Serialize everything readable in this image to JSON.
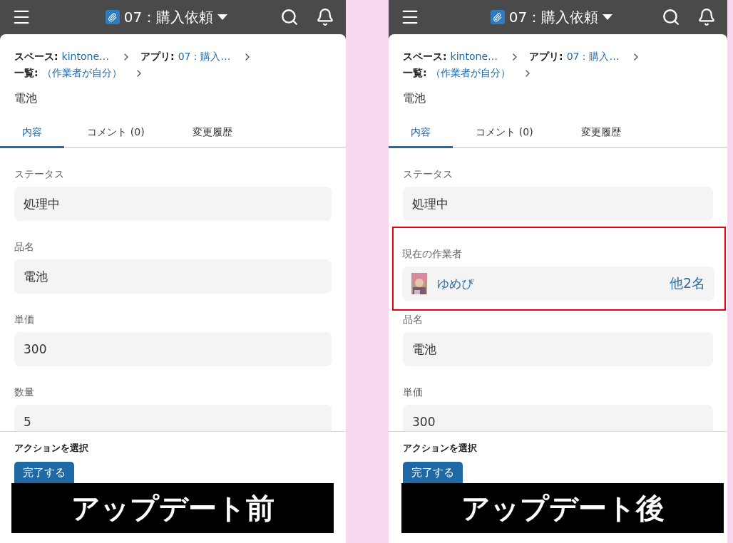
{
  "panels": [
    {
      "header": {
        "app_title": "07：購入依頼"
      },
      "breadcrumb": [
        {
          "label": "スペース:",
          "value": "kintone…"
        },
        {
          "label": "アプリ:",
          "value": "07：購入…"
        },
        {
          "label": "一覧:",
          "value": "（作業者が自分）"
        }
      ],
      "record_title": "電池",
      "tabs": [
        {
          "label": "内容",
          "selected": true
        },
        {
          "label": "コメント (0)",
          "selected": false
        },
        {
          "label": "変更履歴",
          "selected": false
        }
      ],
      "fields": [
        {
          "kind": "text",
          "label": "ステータス",
          "value": "処理中",
          "highlighted": false
        },
        {
          "kind": "text",
          "label": "品名",
          "value": "電池",
          "highlighted": false
        },
        {
          "kind": "text",
          "label": "単価",
          "value": "300",
          "highlighted": false
        },
        {
          "kind": "text",
          "label": "数量",
          "value": "5",
          "highlighted": false
        }
      ],
      "action_label": "アクションを選択",
      "action_button": "完了する",
      "caption": "アップデート前"
    },
    {
      "header": {
        "app_title": "07：購入依頼"
      },
      "breadcrumb": [
        {
          "label": "スペース:",
          "value": "kintone…"
        },
        {
          "label": "アプリ:",
          "value": "07：購入…"
        },
        {
          "label": "一覧:",
          "value": "（作業者が自分）"
        }
      ],
      "record_title": "電池",
      "tabs": [
        {
          "label": "内容",
          "selected": true
        },
        {
          "label": "コメント (0)",
          "selected": false
        },
        {
          "label": "変更履歴",
          "selected": false
        }
      ],
      "fields": [
        {
          "kind": "text",
          "label": "ステータス",
          "value": "処理中",
          "highlighted": false
        },
        {
          "kind": "user",
          "label": "現在の作業者",
          "value": "ゆめぴ",
          "others": "他2名",
          "highlighted": true
        },
        {
          "kind": "text",
          "label": "品名",
          "value": "電池",
          "highlighted": false
        },
        {
          "kind": "text",
          "label": "単価",
          "value": "300",
          "highlighted": false
        }
      ],
      "action_label": "アクションを選択",
      "action_button": "完了する",
      "caption": "アップデート後"
    }
  ]
}
